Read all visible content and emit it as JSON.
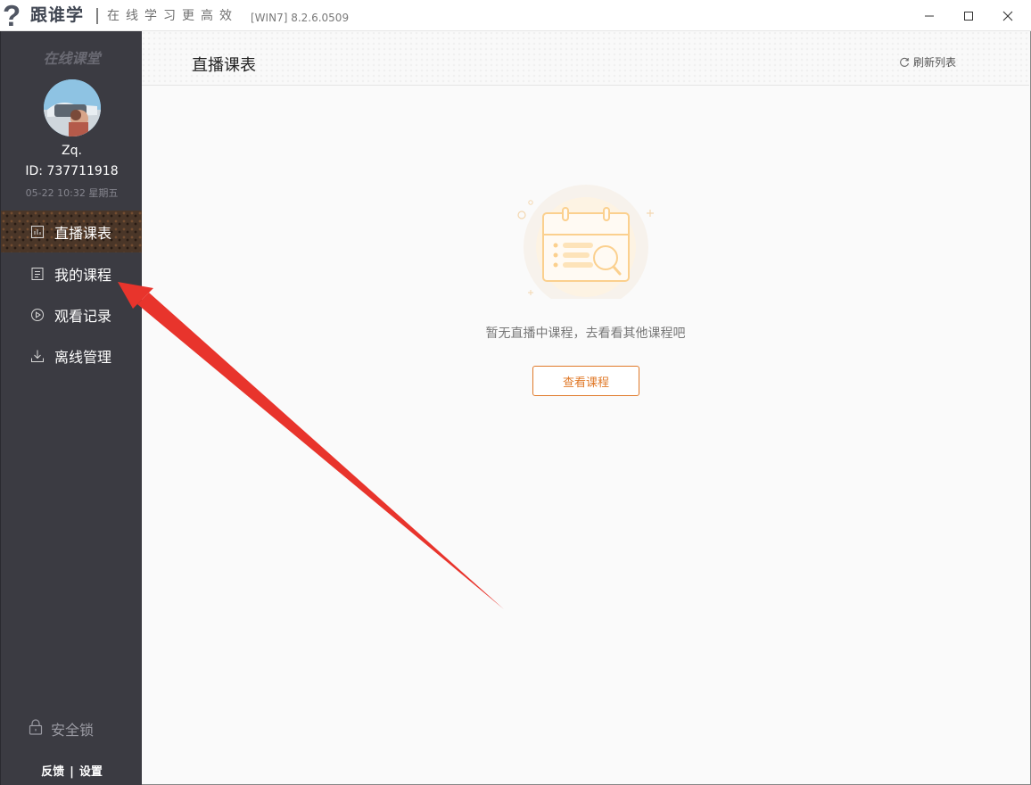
{
  "titlebar": {
    "logo_glyph": "?",
    "brand": "跟谁学",
    "slogan": "在线学习更高效",
    "version": "[WIN7] 8.2.6.0509"
  },
  "sidebar": {
    "section_title": "在线课堂",
    "user": {
      "name": "Zq.",
      "id": "ID: 737711918",
      "datetime": "05-22  10:32  星期五"
    },
    "nav": [
      {
        "label": "直播课表",
        "icon": "bar-chart-icon",
        "active": true
      },
      {
        "label": "我的课程",
        "icon": "document-icon",
        "active": false
      },
      {
        "label": "观看记录",
        "icon": "play-circle-icon",
        "active": false
      },
      {
        "label": "离线管理",
        "icon": "download-icon",
        "active": false
      }
    ],
    "lock_label": "安全锁",
    "footer": {
      "feedback": "反馈",
      "divider": "|",
      "settings": "设置"
    }
  },
  "main": {
    "title": "直播课表",
    "refresh_label": "刷新列表",
    "empty_text": "暂无直播中课程，去看看其他课程吧",
    "view_courses_label": "查看课程"
  },
  "colors": {
    "sidebar_bg": "#3b3b42",
    "accent": "#e07a2a",
    "annotation_arrow": "#e8342c"
  }
}
